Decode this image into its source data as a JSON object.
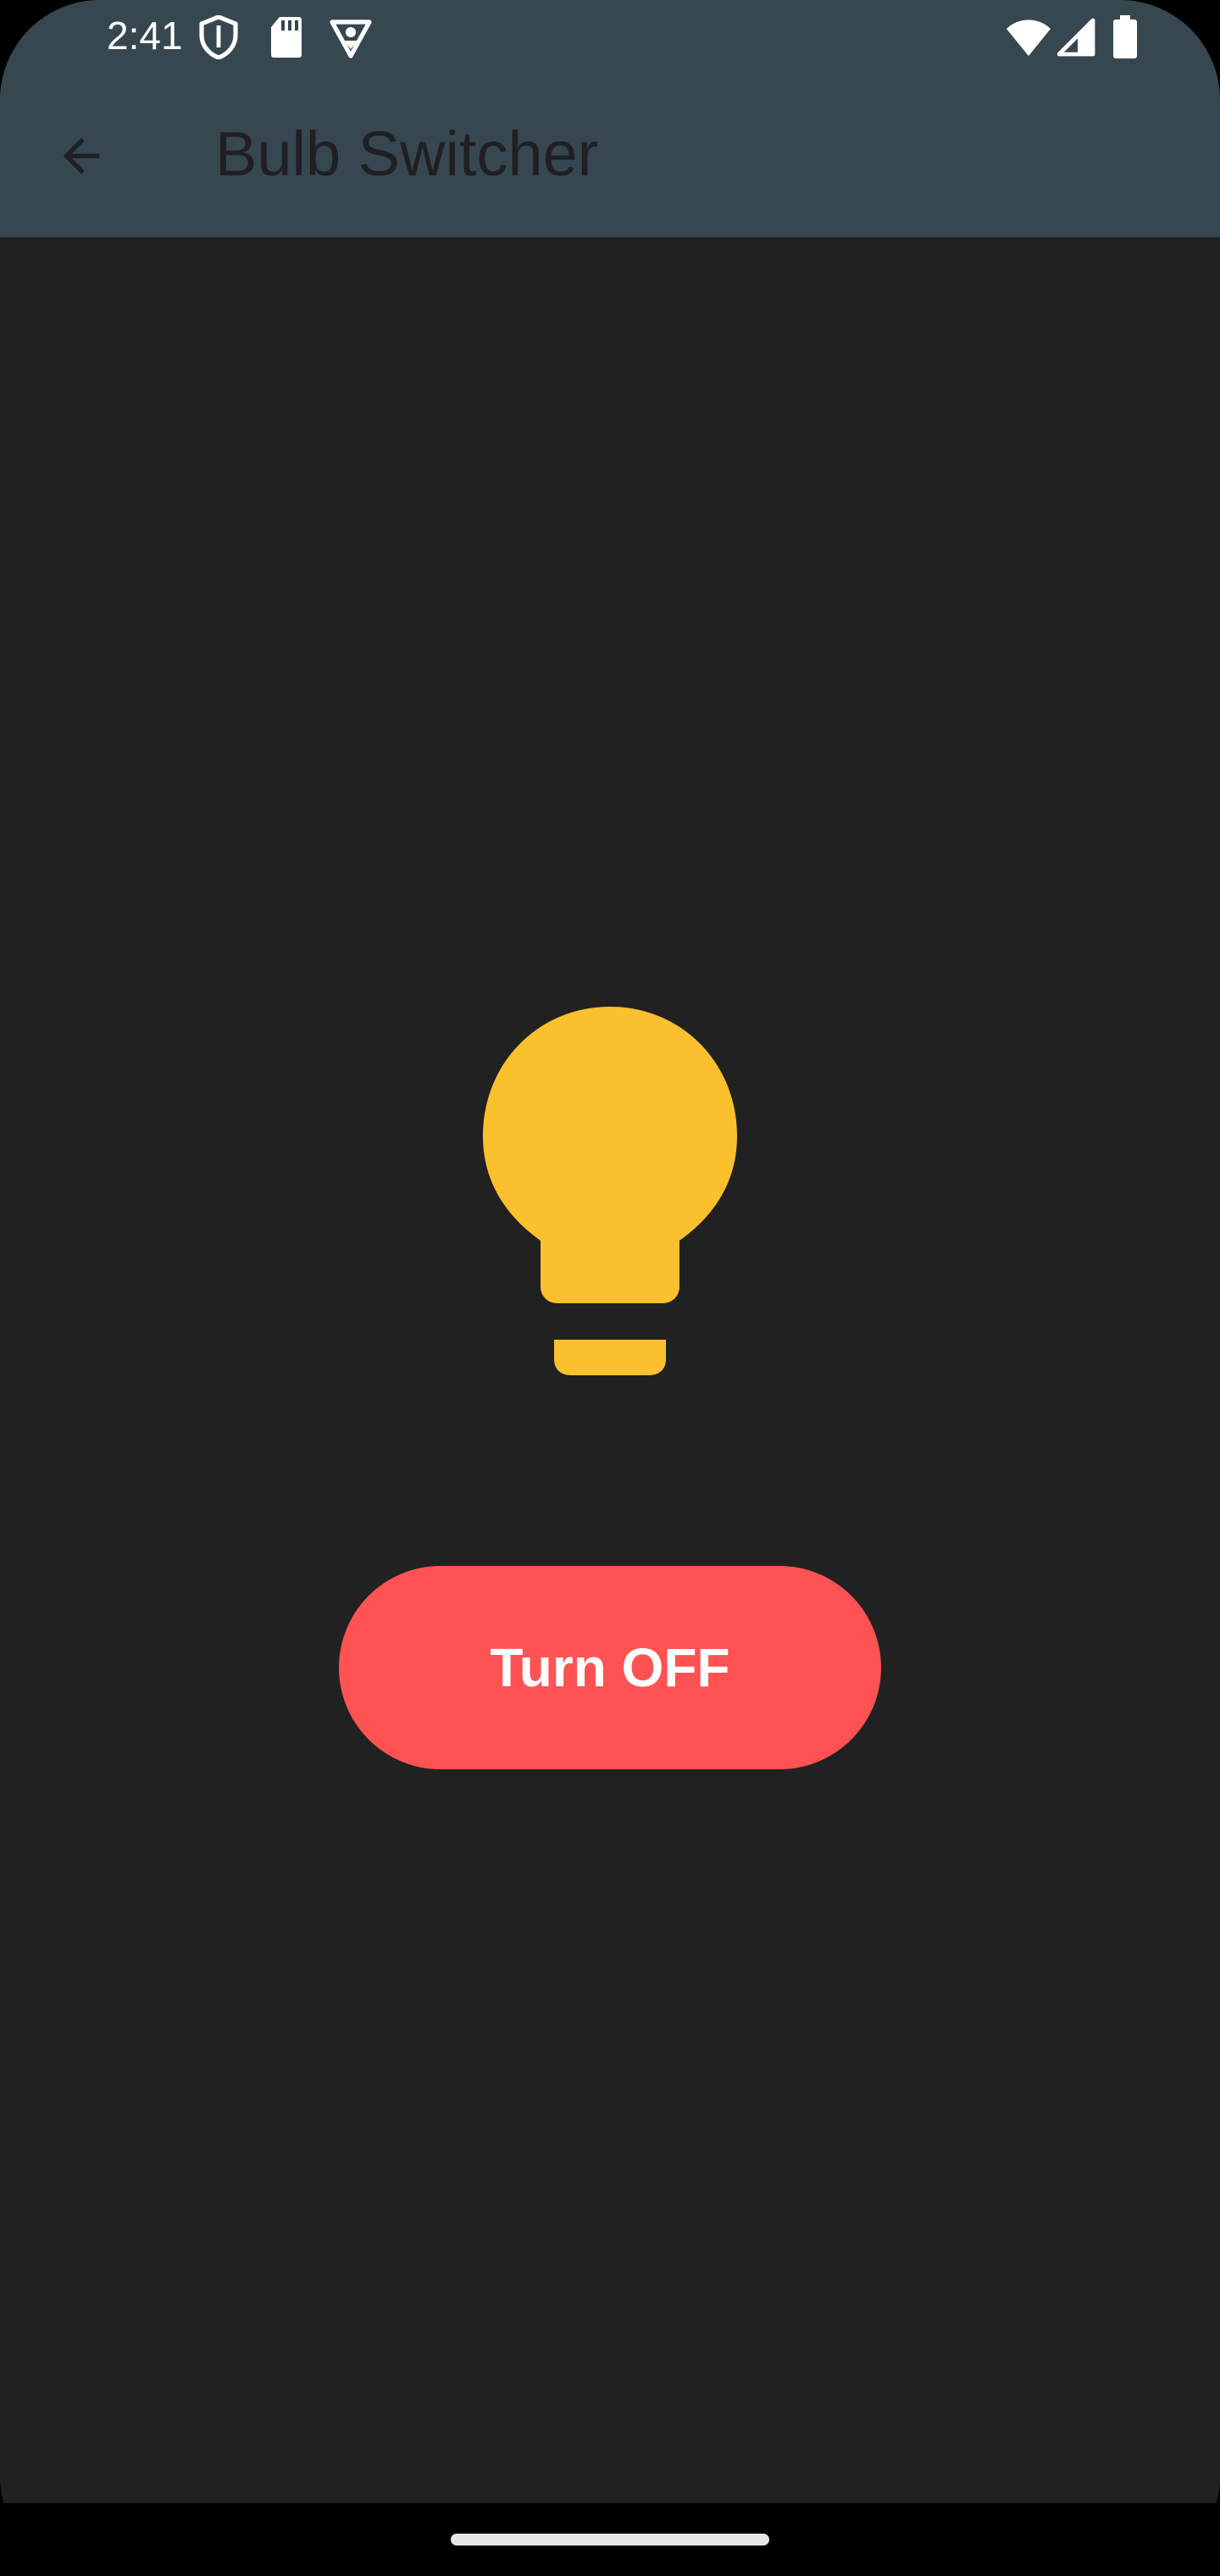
{
  "status_bar": {
    "time": "2:41",
    "left_icons": [
      "shield-icon",
      "sd-card-icon",
      "vpn-key-icon"
    ],
    "right_icons": [
      "wifi-icon",
      "cell-signal-icon",
      "battery-icon"
    ]
  },
  "app_bar": {
    "back_icon": "arrow-back-icon",
    "title": "Bulb Switcher",
    "color": "#37474f"
  },
  "main": {
    "bulb_icon": "lightbulb-icon",
    "bulb_color": "#fbc02d",
    "bulb_state": "on",
    "toggle_label": "Turn OFF",
    "toggle_color": "#ff5252",
    "background": "#212121"
  },
  "nav_bar": {
    "home_indicator": "home-gesture-bar"
  }
}
